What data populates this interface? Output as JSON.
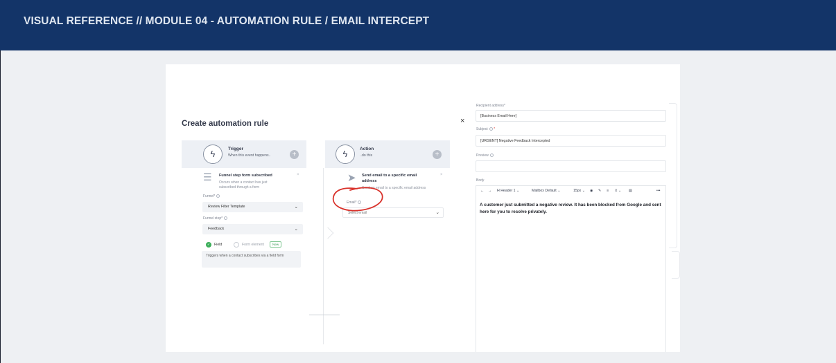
{
  "banner": {
    "title": "VISUAL REFERENCE // MODULE 04 - AUTOMATION RULE / EMAIL INTERCEPT"
  },
  "dialog": {
    "title": "Create automation rule",
    "close": "×"
  },
  "trigger": {
    "title": "Trigger",
    "subtitle": "When this event happens..",
    "card_title": "Funnel step form subscribed",
    "card_desc": "Occurs when a contact has just subscribed through a form",
    "funnel_label": "Funnel*",
    "funnel_value": "Review Filter Template",
    "step_label": "Funnel step*",
    "step_value": "Feedback",
    "radio_field": "Field",
    "radio_form_element": "Form element",
    "new_badge": "New",
    "help_text": "Triggers when a contact subscribes via a field form"
  },
  "action": {
    "title": "Action",
    "subtitle": "..do this",
    "card_title": "Send email to a specific email address",
    "card_desc": "Send an email to a specific email address",
    "email_label": "Email*",
    "email_placeholder": "Select email"
  },
  "right_panel": {
    "recipient_label": "Recipient address*",
    "recipient_value": "[Business Email Here]",
    "subject_label": "Subject",
    "subject_required": "*",
    "subject_value": "[URGENT] Negative Feedback Intercepted",
    "preview_label": "Preview",
    "body_label": "Body",
    "toolbar": {
      "undo": "←",
      "redo": "→",
      "heading": "H Header 1",
      "mailbox": "Mailbox Default",
      "size": "15px",
      "more": "•••"
    },
    "body_text": "A customer just submitted a negative review. It has been blocked from Google and sent here for you to resolve privately."
  },
  "colors": {
    "banner": "#133468",
    "annotation": "#d9322b",
    "radio_on": "#3cae5a"
  }
}
